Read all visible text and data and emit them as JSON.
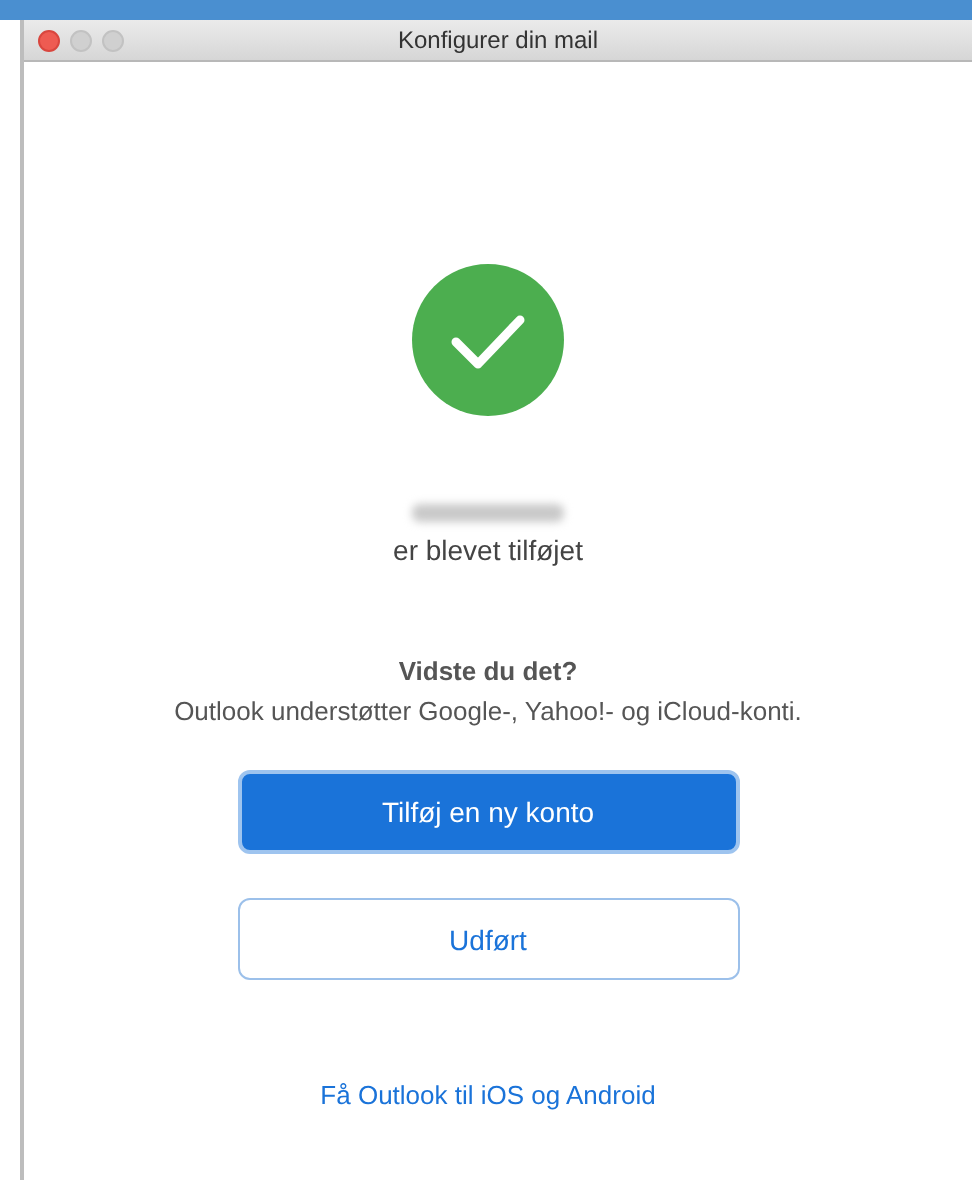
{
  "window": {
    "title": "Konfigurer din mail"
  },
  "status": {
    "kind": "success",
    "message": "er blevet tilføjet"
  },
  "tip": {
    "heading": "Vidste du det?",
    "text": "Outlook understøtter Google-, Yahoo!- og iCloud-konti."
  },
  "buttons": [
    {
      "label": "Tilføj en ny konto",
      "kind": "primary"
    },
    {
      "label": "Udført",
      "kind": "secondary"
    }
  ],
  "link": "Få Outlook til iOS og Android"
}
